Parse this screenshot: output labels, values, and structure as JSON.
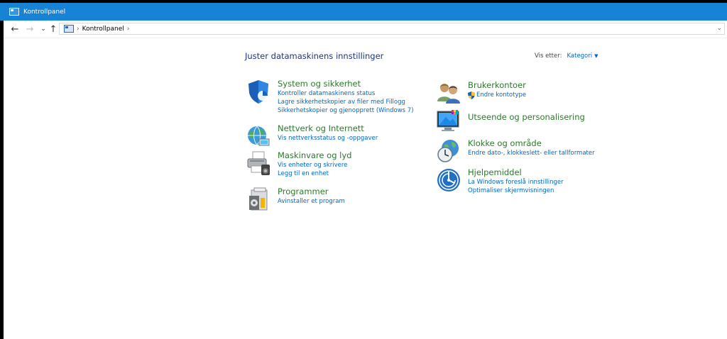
{
  "window": {
    "title": "Kontrollpanel"
  },
  "nav": {
    "back": "←",
    "forward": "→",
    "recent": "⌄",
    "up": "↑",
    "breadcrumb": "Kontrollpanel"
  },
  "main": {
    "heading": "Juster datamaskinens innstillinger",
    "view_by_label": "Vis etter:",
    "view_by_value": "Kategori"
  },
  "categories": [
    {
      "icon": "security-shield-icon",
      "title": "System og sikkerhet",
      "links": [
        "Kontroller datamaskinens status",
        "Lagre sikkerhetskopier av filer med Fillogg",
        "Sikkerhetskopier og gjenopprett (Windows 7)"
      ]
    },
    {
      "icon": "network-globe-icon",
      "title": "Nettverk og Internett",
      "links": [
        "Vis nettverksstatus og -oppgaver"
      ]
    },
    {
      "icon": "printer-icon",
      "title": "Maskinvare og lyd",
      "links": [
        "Vis enheter og skrivere",
        "Legg til en enhet"
      ]
    },
    {
      "icon": "programs-box-icon",
      "title": "Programmer",
      "links": [
        "Avinstaller et program"
      ]
    },
    {
      "icon": "user-accounts-icon",
      "title": "Brukerkontoer",
      "links": [
        "Endre kontotype"
      ]
    },
    {
      "icon": "appearance-monitor-icon",
      "title": "Utseende og personalisering",
      "links": []
    },
    {
      "icon": "clock-globe-icon",
      "title": "Klokke og område",
      "links": [
        "Endre dato-, klokkeslett- eller tallformater"
      ]
    },
    {
      "icon": "ease-of-access-icon",
      "title": "Hjelpemiddel",
      "links": [
        "La Windows foreslå innstillinger",
        "Optimaliser skjermvisningen"
      ]
    }
  ],
  "colors": {
    "titlebar": "#1783d7",
    "heading": "#1e3287",
    "category_title": "#2a7a2a",
    "link": "#0066cc"
  }
}
